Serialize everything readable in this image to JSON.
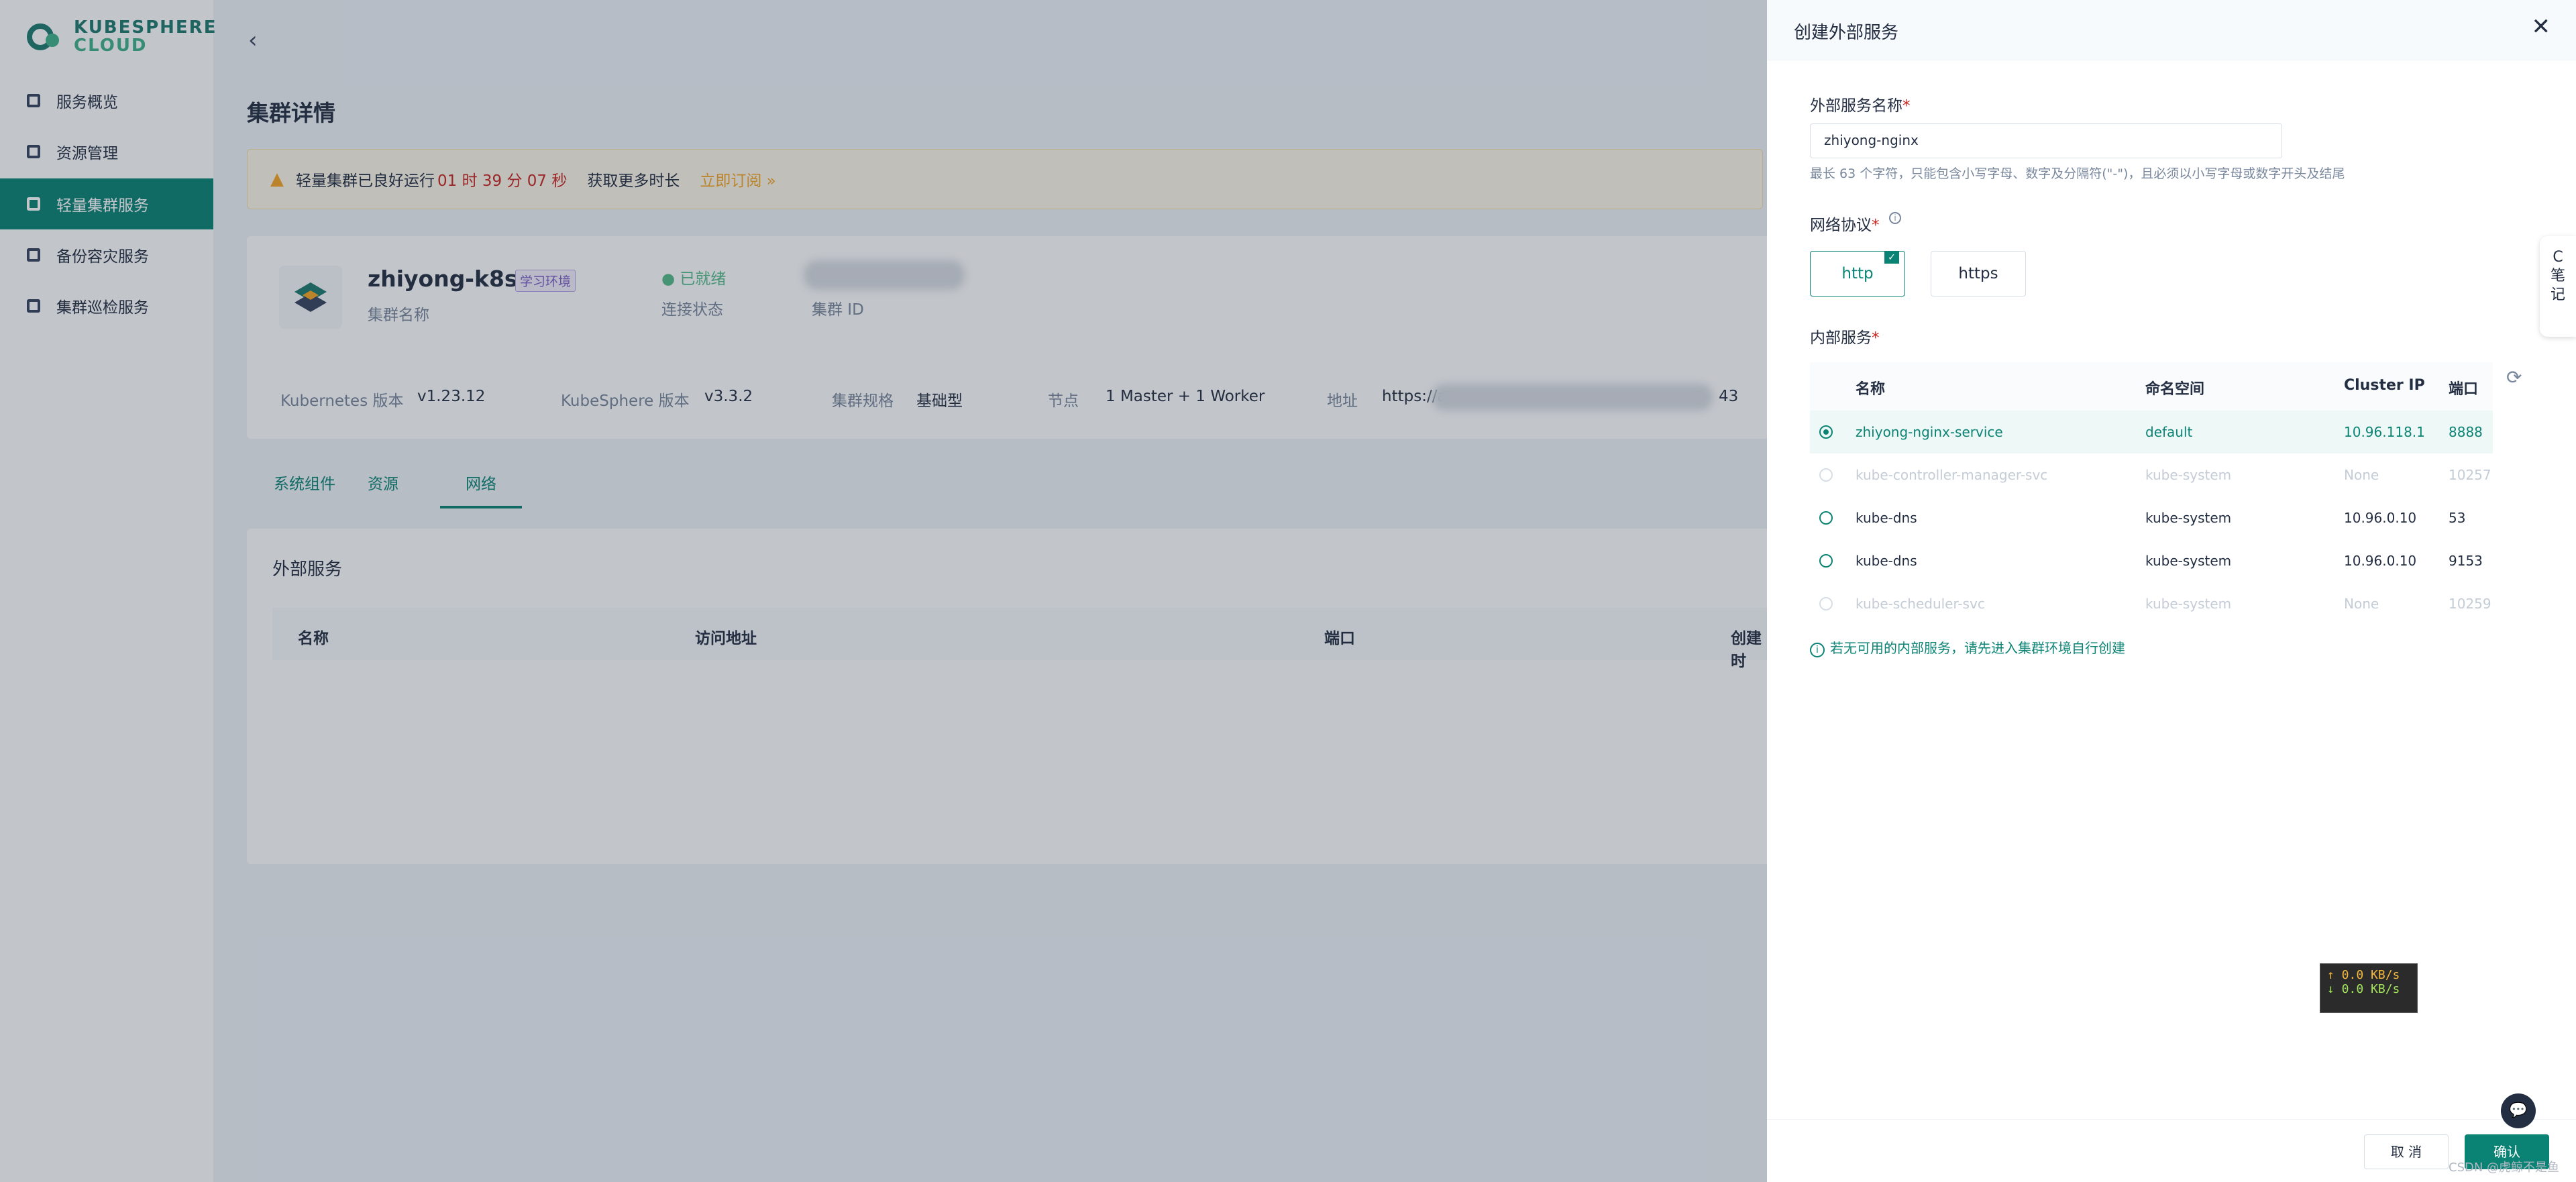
{
  "app": {
    "logo_line1": "KUBESPHERE",
    "logo_line2": "CLOUD"
  },
  "sidebar": {
    "items": [
      {
        "label": "服务概览"
      },
      {
        "label": "资源管理"
      },
      {
        "label": "轻量集群服务"
      },
      {
        "label": "备份容灾服务"
      },
      {
        "label": "集群巡检服务"
      }
    ]
  },
  "page": {
    "back": "‹",
    "title": "集群详情"
  },
  "banner": {
    "text": "轻量集群已良好运行",
    "time": "01 时 39 分 07 秒",
    "more": "获取更多时长",
    "subscribe": "立即订阅 »"
  },
  "cluster": {
    "name": "zhiyong-k8s1",
    "tag": "学习环境",
    "name_label": "集群名称",
    "status": "● 已就绪",
    "status_label": "连接状态",
    "id_label": "集群 ID",
    "k8s_label": "Kubernetes 版本",
    "k8s": "v1.23.12",
    "ks_label": "KubeSphere 版本",
    "ks": "v3.3.2",
    "spec_label": "集群规格",
    "spec": "基础型",
    "node_label": "节点",
    "nodes": "1 Master + 1 Worker",
    "addr_label": "地址",
    "addr_prefix": "https://a",
    "addr_suffix": "43"
  },
  "tabs": [
    {
      "label": "系统组件"
    },
    {
      "label": "资源"
    },
    {
      "label": "网络"
    }
  ],
  "ext": {
    "title": "外部服务",
    "cols": [
      "名称",
      "访问地址",
      "端口",
      "创建时"
    ]
  },
  "drawer": {
    "title": "创建外部服务",
    "close": "✕",
    "name_label": "外部服务名称",
    "name_value": "zhiyong-nginx",
    "name_hint": "最长 63 个字符，只能包含小写字母、数字及分隔符(\"-\")，且必须以小写字母或数字开头及结尾",
    "proto_label": "网络协议",
    "protocols": [
      "http",
      "https"
    ],
    "internal_label": "内部服务",
    "table_cols": [
      "名称",
      "命名空间",
      "Cluster IP",
      "端口"
    ],
    "rows": [
      {
        "name": "zhiyong-nginx-service",
        "ns": "default",
        "ip": "10.96.118.1",
        "port": "8888"
      },
      {
        "name": "kube-controller-manager-svc",
        "ns": "kube-system",
        "ip": "None",
        "port": "10257"
      },
      {
        "name": "kube-dns",
        "ns": "kube-system",
        "ip": "10.96.0.10",
        "port": "53"
      },
      {
        "name": "kube-dns",
        "ns": "kube-system",
        "ip": "10.96.0.10",
        "port": "9153"
      },
      {
        "name": "kube-scheduler-svc",
        "ns": "kube-system",
        "ip": "None",
        "port": "10259"
      }
    ],
    "note": "若无可用的内部服务，请先进入集群环境自行创建",
    "cancel": "取 消",
    "ok": "确认"
  },
  "net": {
    "up": "↑ 0.0 KB/s",
    "down": "↓ 0.0 KB/s"
  },
  "side_note": {
    "c": "C",
    "t1": "笔",
    "t2": "记"
  },
  "watermark": "CSDN @虎鲸不是鱼"
}
